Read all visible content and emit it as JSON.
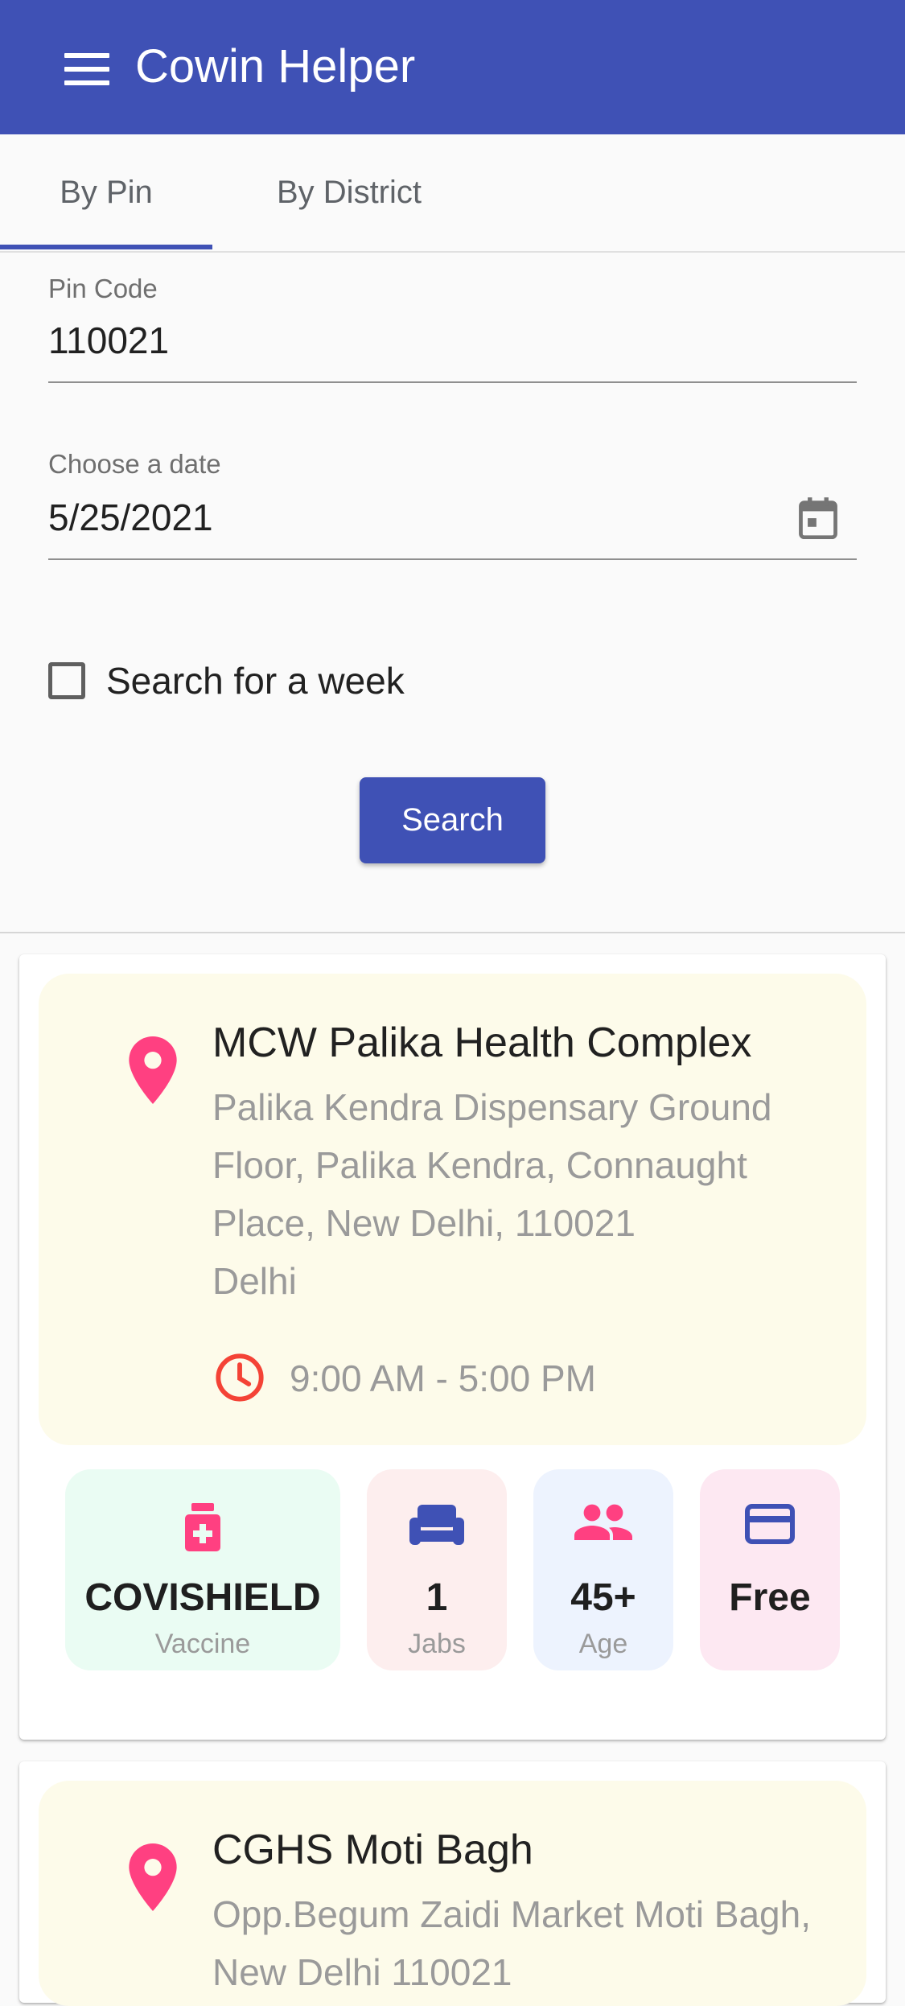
{
  "app": {
    "title": "Cowin Helper"
  },
  "tabs": [
    {
      "label": "By Pin",
      "active": true
    },
    {
      "label": "By District",
      "active": false
    }
  ],
  "form": {
    "pin": {
      "label": "Pin Code",
      "value": "110021"
    },
    "date": {
      "label": "Choose a date",
      "value": "5/25/2021"
    },
    "week_checkbox": {
      "label": "Search for a week",
      "checked": false
    },
    "search_button": "Search"
  },
  "results": [
    {
      "name": "MCW Palika Health Complex",
      "address": "Palika Kendra Dispensary Ground Floor, Palika Kendra, Connaught Place, New Delhi, 110021",
      "state": "Delhi",
      "time": "9:00 AM - 5:00 PM",
      "vaccine": {
        "value": "COVISHIELD",
        "label": "Vaccine"
      },
      "jabs": {
        "value": "1",
        "label": "Jabs"
      },
      "age": {
        "value": "45+",
        "label": "Age"
      },
      "fee": {
        "value": "Free"
      }
    },
    {
      "name": "CGHS Moti Bagh",
      "address": "Opp.Begum Zaidi Market Moti Bagh, New Delhi 110021"
    }
  ],
  "colors": {
    "primary": "#3f51b5",
    "pink": "#ff4081",
    "red": "#f44336",
    "info_bg": "#fdfbea",
    "vaccine_bg": "#eafcf3",
    "jabs_bg": "#fdeeee",
    "age_bg": "#edf3fe",
    "fee_bg": "#fde8f2"
  }
}
